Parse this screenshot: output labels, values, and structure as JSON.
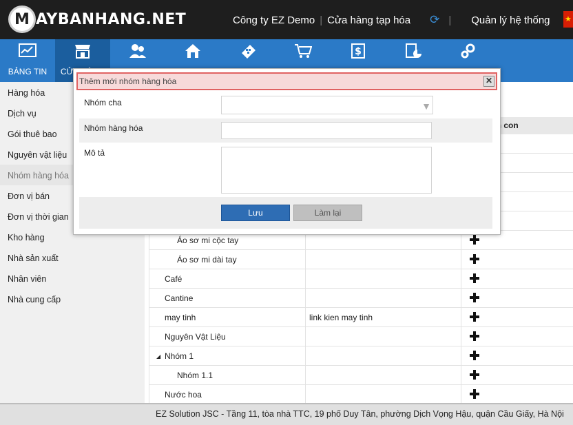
{
  "header": {
    "logo_letter": "M",
    "logo_text": "AYBANHANG.NET",
    "company": "Công ty EZ Demo",
    "store": "Cửa hàng tạp hóa",
    "manage": "Quản lý hệ thống",
    "refresh_icon": "refresh-icon",
    "flag": "vietnam-flag"
  },
  "nav": {
    "items": [
      {
        "label": "BẢNG TIN",
        "icon": "dashboard-icon"
      },
      {
        "label": "CỬA HÀNG",
        "icon": "store-icon"
      },
      {
        "label": "",
        "icon": "customers-icon"
      },
      {
        "label": "",
        "icon": "home-icon"
      },
      {
        "label": "",
        "icon": "calculator-icon"
      },
      {
        "label": "",
        "icon": "cart-icon"
      },
      {
        "label": "",
        "icon": "money-icon"
      },
      {
        "label": "",
        "icon": "report-icon"
      },
      {
        "label": "",
        "icon": "settings-icon"
      }
    ]
  },
  "sidebar": {
    "items": [
      {
        "label": "Hàng hóa"
      },
      {
        "label": "Dịch vụ"
      },
      {
        "label": "Gói thuê bao"
      },
      {
        "label": "Nguyên vật liệu"
      },
      {
        "label": "Nhóm hàng hóa"
      },
      {
        "label": "Đơn vị bán"
      },
      {
        "label": "Đơn vị thời gian"
      },
      {
        "label": "Kho hàng"
      },
      {
        "label": "Nhà sản xuất"
      },
      {
        "label": "Nhân viên"
      },
      {
        "label": "Nhà cung cấp"
      }
    ]
  },
  "table": {
    "column_header": "Thêm nhóm con",
    "rows": [
      {
        "name": "",
        "desc": ""
      },
      {
        "name": "",
        "desc": ""
      },
      {
        "name": "",
        "desc": ""
      },
      {
        "name": "",
        "desc": ""
      },
      {
        "name": "",
        "desc": ""
      },
      {
        "name": "Áo sơ mi cộc tay",
        "desc": ""
      },
      {
        "name": "Áo sơ mi dài tay",
        "desc": ""
      },
      {
        "name": "Café",
        "desc": ""
      },
      {
        "name": "Cantine",
        "desc": ""
      },
      {
        "name": "may tinh",
        "desc": "link kien may tinh"
      },
      {
        "name": "Nguyên Vật Liệu",
        "desc": ""
      },
      {
        "name": "Nhóm 1",
        "desc": "",
        "expand": "◢"
      },
      {
        "name": "Nhóm 1.1",
        "desc": ""
      },
      {
        "name": "Nước hoa",
        "desc": ""
      }
    ]
  },
  "modal": {
    "title": "Thêm mới nhóm hàng hóa",
    "close": "✕",
    "parent_label": "Nhóm cha",
    "parent_value": "",
    "group_label": "Nhóm hàng hóa",
    "group_value": "",
    "desc_label": "Mô tả",
    "desc_value": "",
    "save": "Lưu",
    "reset": "Làm lại"
  },
  "footer": {
    "text": "EZ Solution JSC - Tầng 11, tòa nhà TTC, 19 phố Duy Tân, phường Dịch Vọng Hậu, quận Cầu Giấy, Hà Nội"
  },
  "colors": {
    "nav_bg": "#2b7ac7",
    "nav_active": "#1b5e9e",
    "topbar_bg": "#1e1e1e",
    "primary_button": "#2e6db4",
    "modal_title_bg": "#f7dada",
    "modal_title_border": "#e06262"
  }
}
